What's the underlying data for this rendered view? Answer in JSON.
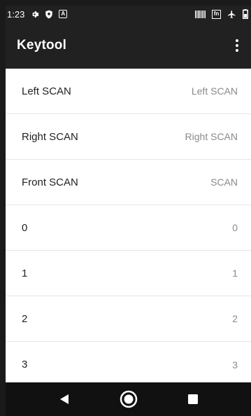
{
  "status_bar": {
    "time": "1:23",
    "icons_left": [
      "settings-icon",
      "shield-icon",
      "a-badge-icon"
    ],
    "icons_right": [
      "barcode-icon",
      "fn-icon",
      "airplane-icon",
      "battery-icon"
    ],
    "fn_label": "fn",
    "a_label": "A"
  },
  "app_bar": {
    "title": "Keytool",
    "menu_icon": "more-vert-icon"
  },
  "list": {
    "items": [
      {
        "title": "Left SCAN",
        "value": "Left SCAN"
      },
      {
        "title": "Right SCAN",
        "value": "Right SCAN"
      },
      {
        "title": "Front SCAN",
        "value": "SCAN"
      },
      {
        "title": "0",
        "value": "0"
      },
      {
        "title": "1",
        "value": "1"
      },
      {
        "title": "2",
        "value": "2"
      },
      {
        "title": "3",
        "value": "3"
      }
    ]
  },
  "nav_bar": {
    "buttons": [
      "back-icon",
      "home-icon",
      "recents-icon"
    ]
  },
  "colors": {
    "bar_background": "#212121",
    "nav_background": "#111111",
    "list_background": "#ffffff",
    "title_text": "#222222",
    "value_text": "#8a8a8a",
    "divider": "#e6e6e6"
  }
}
